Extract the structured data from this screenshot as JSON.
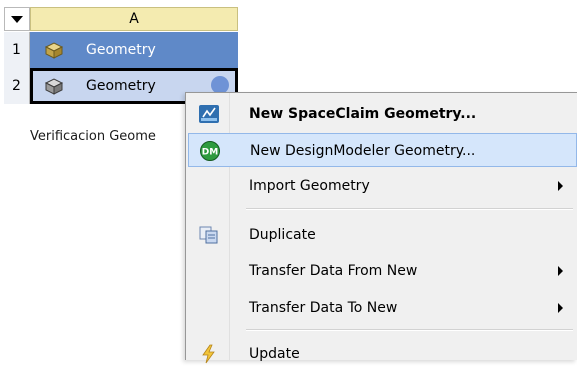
{
  "system": {
    "column_header": "A",
    "rows": [
      {
        "number": "1",
        "label": "Geometry",
        "icon": "geometry-system-icon"
      },
      {
        "number": "2",
        "label": "Geometry",
        "icon": "geometry-cell-icon"
      }
    ],
    "system_name": "Verificacion Geome"
  },
  "context_menu": {
    "items": [
      {
        "label": "New SpaceClaim Geometry...",
        "icon": "spaceclaim-icon",
        "bold": true
      },
      {
        "label": "New DesignModeler Geometry...",
        "icon": "designmodeler-icon",
        "icon_text": "DM",
        "highlighted": true
      },
      {
        "label": "Import Geometry",
        "submenu": true
      },
      {
        "label": "Duplicate",
        "icon": "duplicate-icon"
      },
      {
        "label": "Transfer Data From New",
        "submenu": true
      },
      {
        "label": "Transfer Data To New",
        "submenu": true
      },
      {
        "label": "Update",
        "icon": "update-icon"
      }
    ]
  },
  "colors": {
    "header_fill": "#f4ebb0",
    "row_system": "#5f89c8",
    "row_selected": "#c8d6ef",
    "menu_highlight": "#d5e6fb",
    "designmodeler_green": "#2e9b3f"
  }
}
